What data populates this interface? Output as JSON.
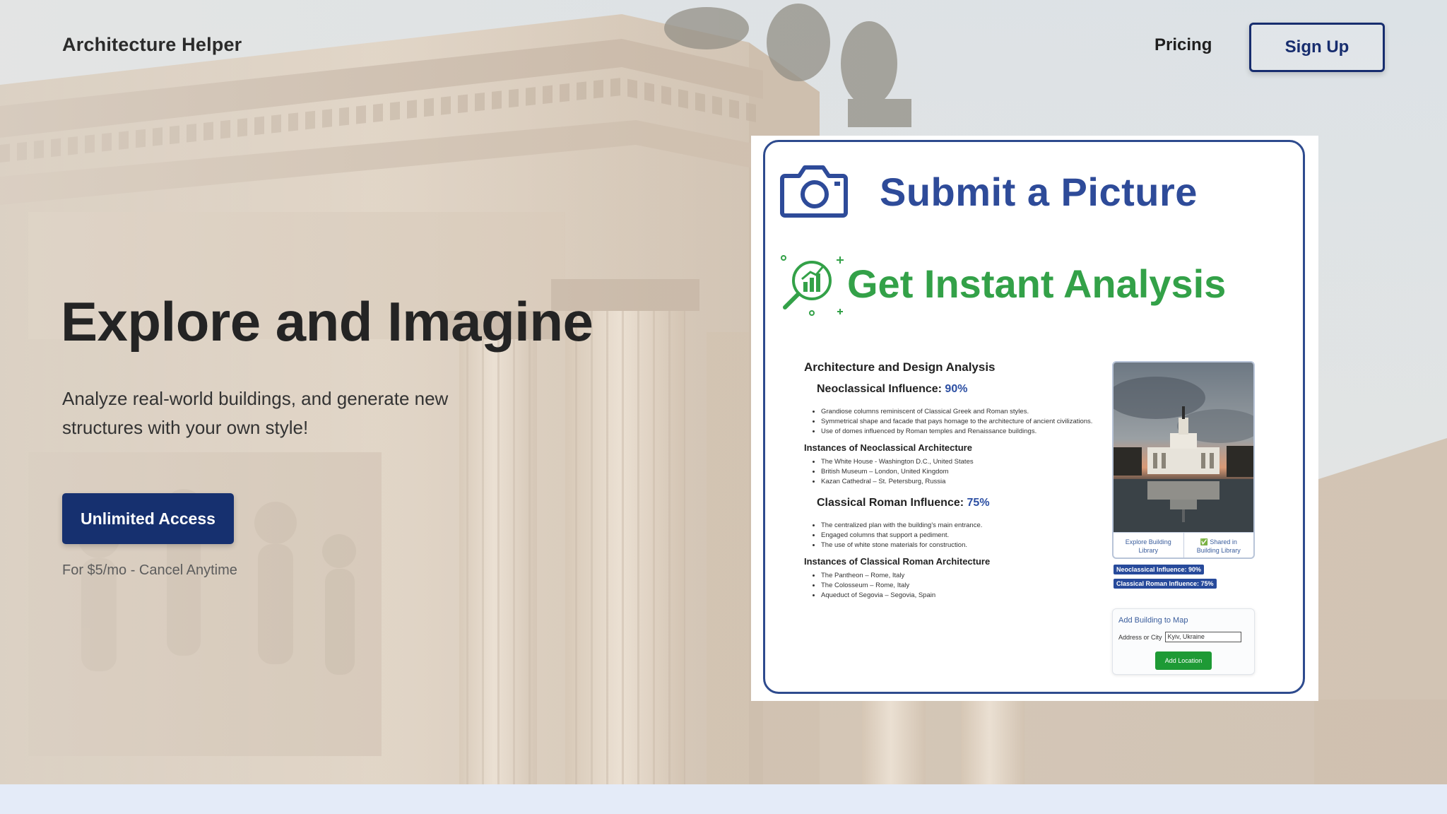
{
  "brand": "Architecture Helper",
  "nav": {
    "pricing": "Pricing",
    "signup": "Sign Up"
  },
  "hero": {
    "headline": "Explore and Imagine",
    "subtitle": "Analyze real-world buildings, and generate new structures with your own style!",
    "cta": "Unlimited Access",
    "price_note": "For $5/mo - Cancel Anytime"
  },
  "preview": {
    "step1": "Submit a Picture",
    "step2": "Get Instant Analysis",
    "report": {
      "title": "Architecture and Design Analysis",
      "neo_label": "Neoclassical Influence:",
      "neo_pct": "90%",
      "neo_points": [
        "Grandiose columns reminiscent of Classical Greek and Roman styles.",
        "Symmetrical shape and facade that pays homage to the architecture of ancient civilizations.",
        "Use of domes influenced by Roman temples and Renaissance buildings."
      ],
      "neo_instances_title": "Instances of Neoclassical Architecture",
      "neo_instances": [
        "The White House - Washington D.C., United States",
        "British Museum – London, United Kingdom",
        "Kazan Cathedral – St. Petersburg, Russia"
      ],
      "roman_label": "Classical Roman Influence:",
      "roman_pct": "75%",
      "roman_points": [
        "The centralized plan with the building's main entrance.",
        "Engaged columns that support a pediment.",
        "The use of white stone materials for construction."
      ],
      "roman_instances_title": "Instances of Classical Roman Architecture",
      "roman_instances": [
        "The Pantheon – Rome, Italy",
        "The Colosseum – Rome, Italy",
        "Aqueduct of Segovia – Segovia, Spain"
      ]
    },
    "side": {
      "explore": "Explore Building Library",
      "shared": "✅ Shared in Building Library",
      "badge_neo": "Neoclassical Influence: 90%",
      "badge_roman": "Classical Roman Influence: 75%",
      "map_title": "Add Building to Map",
      "map_label": "Address or City",
      "map_value": "Kyiv, Ukraine",
      "map_button": "Add Location"
    }
  },
  "colors": {
    "navy": "#16306f",
    "step1_blue": "#2e4b99",
    "step2_green": "#33a148"
  }
}
